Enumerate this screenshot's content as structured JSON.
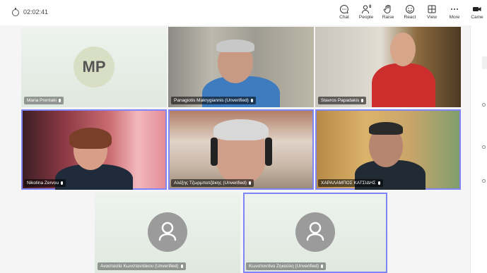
{
  "call": {
    "timer": "02:02:41"
  },
  "toolbar": {
    "items": [
      {
        "label": "Chat",
        "icon": "chat-icon",
        "active": true
      },
      {
        "label": "People",
        "icon": "people-icon",
        "badge": "8"
      },
      {
        "label": "Raise",
        "icon": "hand-icon"
      },
      {
        "label": "React",
        "icon": "emoji-icon"
      },
      {
        "label": "View",
        "icon": "grid-icon"
      },
      {
        "label": "More",
        "icon": "more-icon"
      },
      {
        "label": "Came",
        "icon": "camera-icon"
      }
    ]
  },
  "participants": [
    {
      "name": "Maria Prentaki",
      "initials": "MP",
      "type": "avatar"
    },
    {
      "name": "Panagiotis Makrygiannis (Unverified)",
      "type": "video"
    },
    {
      "name": "Stavros Papadakis",
      "type": "video"
    },
    {
      "name": "Nikolina Zervou",
      "type": "video",
      "speaking": true
    },
    {
      "name": "Αλέξης Τζωρμπατζάκης (Unverified)",
      "type": "video",
      "speaking": true
    },
    {
      "name": "ΧΑΡΑΛΑΜΠΟΣ ΚΑΤΣΙΔΗΣ",
      "type": "video",
      "speaking": true
    },
    {
      "name": "Αναστασία Κωνσταντάκου (Unverified)",
      "type": "placeholder"
    },
    {
      "name": "Κωνσταντίνα Ζηκούλη (Unverified)",
      "type": "placeholder",
      "speaking": true
    }
  ],
  "colors": {
    "accent": "#5b5fc7",
    "speaking_border": "#7f85f5"
  }
}
